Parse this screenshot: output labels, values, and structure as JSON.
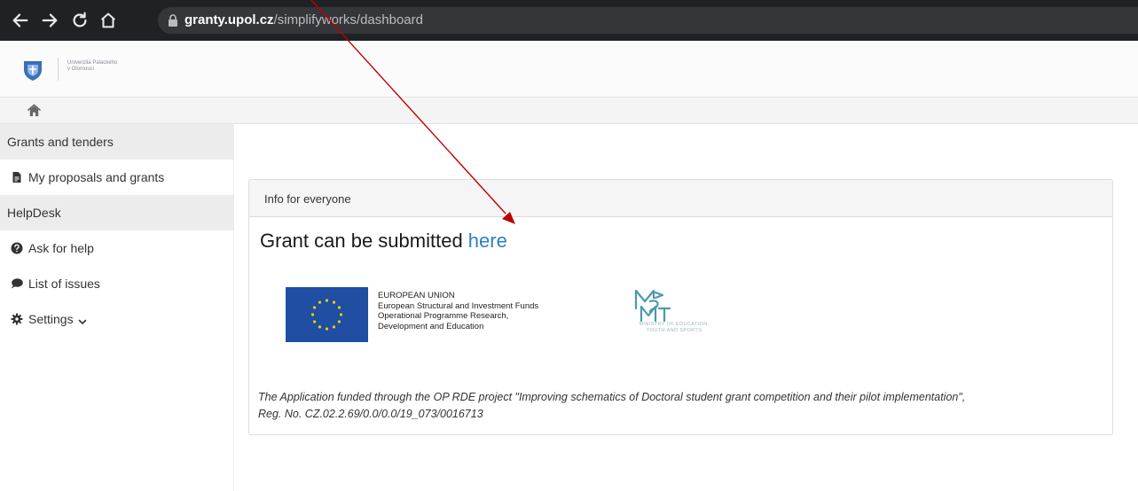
{
  "browser": {
    "url_host": "granty.upol.cz",
    "url_path": "/simplifyworks/dashboard",
    "icons": [
      "back-arrow-icon",
      "forward-arrow-icon",
      "reload-icon",
      "home-icon",
      "lock-icon"
    ]
  },
  "header": {
    "logo_text_line1": "Univerzita Palackého",
    "logo_text_line2": "v Olomouci"
  },
  "sidebar": {
    "section_grants": "Grants and tenders",
    "item_proposals": "My proposals and grants",
    "section_helpdesk": "HelpDesk",
    "item_ask_help": "Ask for help",
    "item_issues": "List of issues",
    "item_settings": "Settings"
  },
  "panel": {
    "header": "Info for everyone",
    "title_prefix": "Grant can be submitted ",
    "title_link": "here",
    "eu_line1": "EUROPEAN UNION",
    "eu_line2": "European Structural and Investment Funds",
    "eu_line3": "Operational Programme Research,",
    "eu_line4": "Development and Education",
    "msmt_line1": "MINISTRY OF EDUCATION,",
    "msmt_line2": "YOUTH AND SPORTS",
    "footnote_line1": "The Application funded through the OP RDE project \"Improving schematics of Doctoral student grant competition and their pilot implementation\",",
    "footnote_line2": "Reg. No. CZ.02.2.69/0.0/0.0/19_073/0016713"
  },
  "colors": {
    "browser_bar": "#202124",
    "link": "#2f7fc1",
    "eu_blue": "#1f4ea3",
    "eu_star": "#f5d000",
    "annotation_arrow": "#c00000",
    "msmt_teal": "#4a9aa8"
  }
}
